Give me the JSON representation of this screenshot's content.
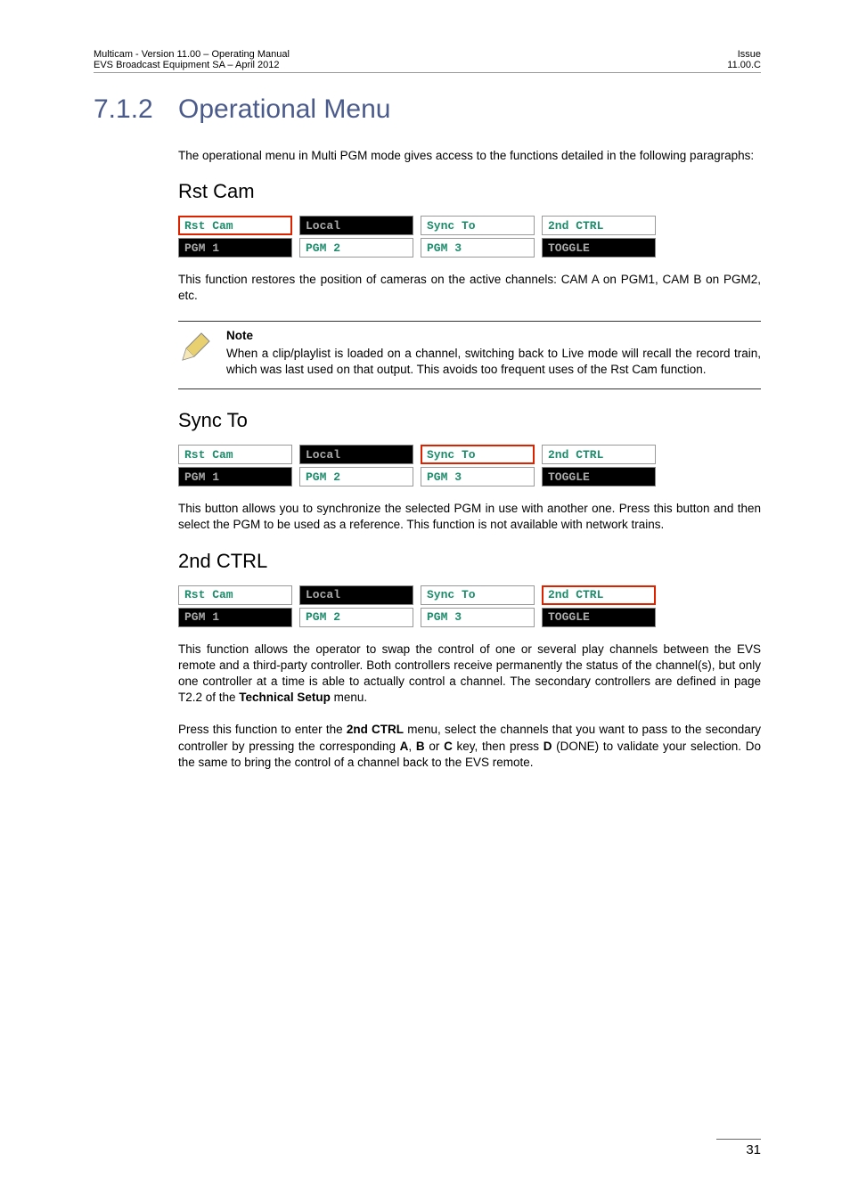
{
  "header": {
    "left_line1": "Multicam - Version 11.00 – Operating Manual",
    "left_line2": "EVS Broadcast Equipment SA – April 2012",
    "right_line1": "Issue",
    "right_line2": "11.00.C"
  },
  "section": {
    "number": "7.1.2",
    "title": "Operational Menu",
    "intro": "The operational menu in Multi PGM mode gives access to the functions detailed in the following paragraphs:"
  },
  "rstcam": {
    "heading": "Rst Cam",
    "cells": {
      "c1": "Rst Cam",
      "c2": "Local",
      "c3": "Sync To",
      "c4": "2nd CTRL",
      "c5": "PGM 1",
      "c6": "PGM 2",
      "c7": "PGM 3",
      "c8": "TOGGLE"
    },
    "text": "This function restores the position of cameras on the active channels: CAM A on PGM1, CAM B on PGM2, etc."
  },
  "note": {
    "title": "Note",
    "text": "When a clip/playlist is loaded on a channel, switching back to Live mode will recall the record train, which was last used on that output. This avoids too frequent uses of the Rst Cam function."
  },
  "syncto": {
    "heading": "Sync To",
    "cells": {
      "c1": "Rst Cam",
      "c2": "Local",
      "c3": "Sync To",
      "c4": "2nd CTRL",
      "c5": "PGM 1",
      "c6": "PGM 2",
      "c7": "PGM 3",
      "c8": "TOGGLE"
    },
    "text": "This button allows you to synchronize the selected PGM in use with another one. Press this button and then select the PGM to be used as a reference. This function is not available with network trains."
  },
  "secondctrl": {
    "heading": "2nd CTRL",
    "cells": {
      "c1": "Rst Cam",
      "c2": "Local",
      "c3": "Sync To",
      "c4": "2nd CTRL",
      "c5": "PGM 1",
      "c6": "PGM 2",
      "c7": "PGM 3",
      "c8": "TOGGLE"
    },
    "para1_a": "This function allows the operator to swap the control of one or several play channels between the EVS remote and a third-party controller. Both controllers receive permanently the status of the channel(s), but only one controller at a time is able to actually control a channel. The secondary controllers are defined in page T2.2 of the ",
    "para1_b": "Technical Setup",
    "para1_c": " menu.",
    "para2_a": "Press this function to enter the ",
    "para2_b": "2nd CTRL",
    "para2_c": " menu, select the channels that you want to pass to the secondary controller by pressing the corresponding ",
    "para2_d": "A",
    "para2_e": ", ",
    "para2_f": "B",
    "para2_g": " or ",
    "para2_h": "C",
    "para2_i": " key, then press ",
    "para2_j": "D",
    "para2_k": " (DONE) to validate your selection. Do the same to bring the control of a channel back to the EVS remote."
  },
  "pagenum": "31"
}
